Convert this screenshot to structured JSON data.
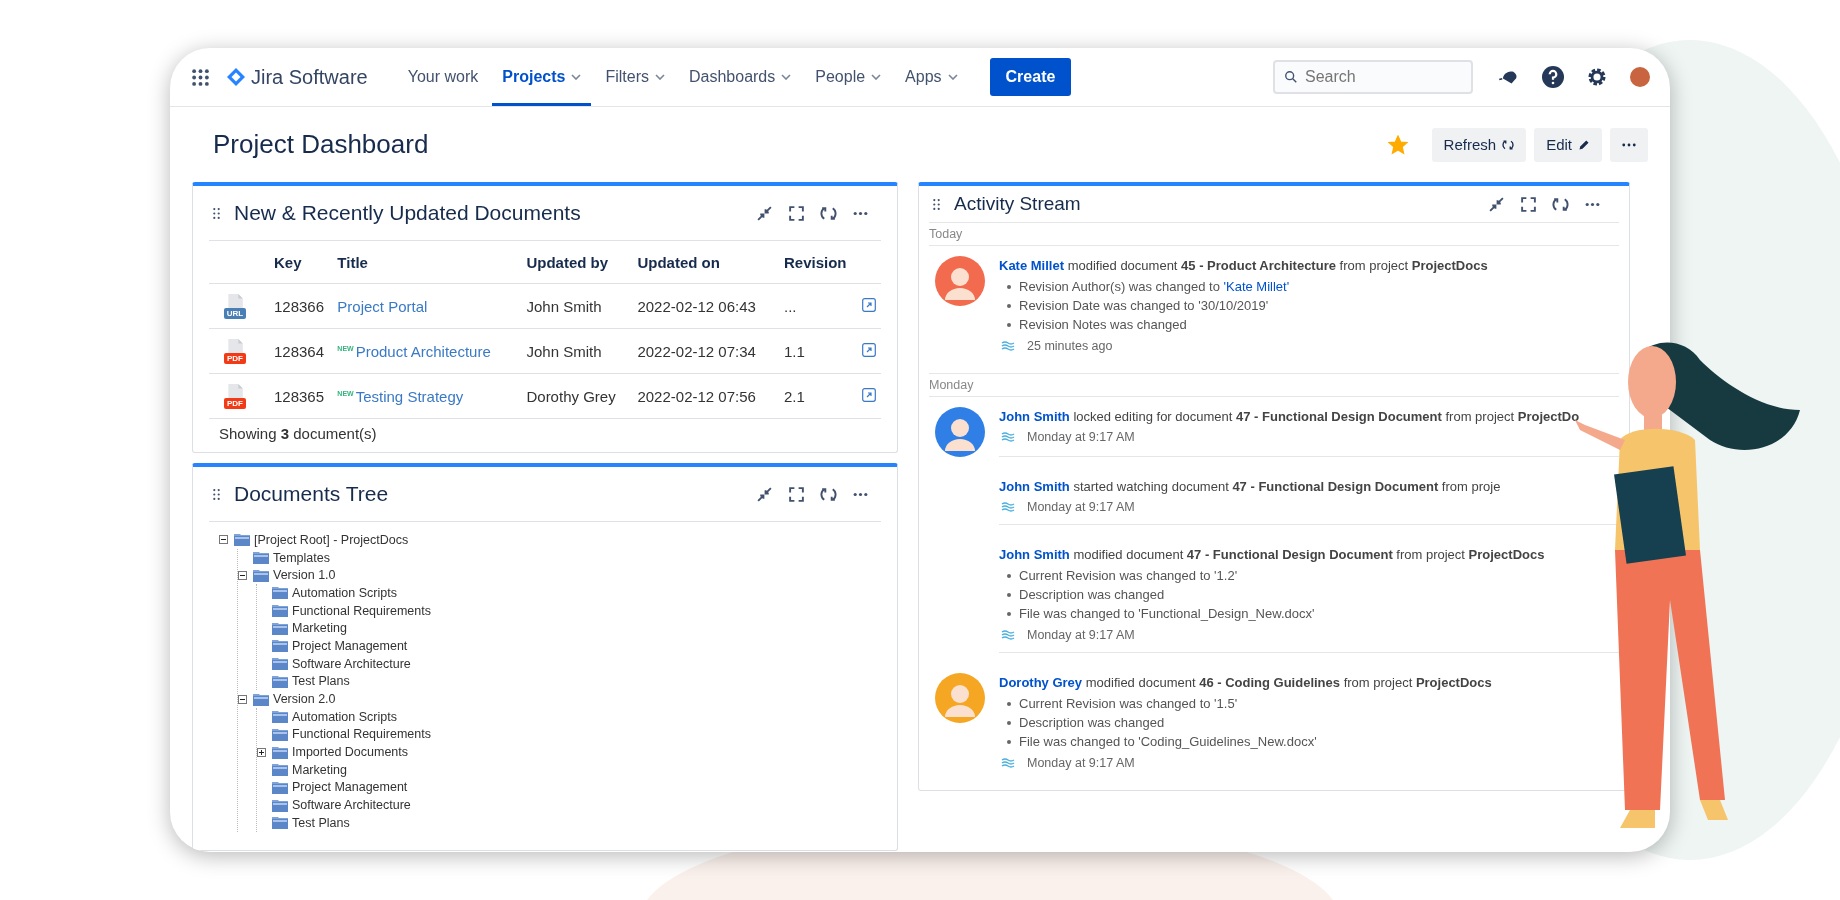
{
  "nav": {
    "product": "Jira Software",
    "items": [
      {
        "label": "Your work",
        "selected": false,
        "has_menu": false
      },
      {
        "label": "Projects",
        "selected": true,
        "has_menu": true
      },
      {
        "label": "Filters",
        "selected": false,
        "has_menu": true
      },
      {
        "label": "Dashboards",
        "selected": false,
        "has_menu": true
      },
      {
        "label": "People",
        "selected": false,
        "has_menu": true
      },
      {
        "label": "Apps",
        "selected": false,
        "has_menu": true
      }
    ],
    "create": "Create",
    "search": {
      "placeholder": "Search"
    }
  },
  "page": {
    "title": "Project Dashboard",
    "starred": true,
    "buttons": [
      "Refresh",
      "Edit"
    ]
  },
  "documents": {
    "title": "New & Recently Updated Documents",
    "columns": [
      "Key",
      "Title",
      "Updated by",
      "Updated on",
      "Revision"
    ],
    "rows": [
      {
        "kind": "url",
        "file_label": "URL",
        "key": "128366",
        "title": "Project Portal",
        "updated_by": "John Smith",
        "updated_on": "2022-02-12 06:43",
        "revision": "..."
      },
      {
        "kind": "pdf",
        "file_label": "PDF",
        "key": "128364",
        "badge": "NEW",
        "title": "Product Architecture",
        "updated_by": "John Smith",
        "updated_on": "2022-02-12 07:34",
        "revision": "1.1"
      },
      {
        "kind": "pdf",
        "file_label": "PDF",
        "key": "128365",
        "badge": "NEW",
        "title": "Testing Strategy",
        "updated_by": "Dorothy Grey",
        "updated_on": "2022-02-12 07:56",
        "revision": "2.1"
      }
    ],
    "footer": "Showing **3** document(s)"
  },
  "tree": {
    "title": "Documents Tree",
    "nodes": [
      {
        "label": "[Project Root] - ProjectDocs",
        "expanded": true,
        "children": [
          {
            "label": "Templates"
          },
          {
            "label": "Version 1.0",
            "expanded": true,
            "children": [
              {
                "label": "Automation Scripts"
              },
              {
                "label": "Functional Requirements"
              },
              {
                "label": "Marketing"
              },
              {
                "label": "Project Management"
              },
              {
                "label": "Software Architecture"
              },
              {
                "label": "Test Plans"
              }
            ]
          },
          {
            "label": "Version 2.0",
            "expanded": true,
            "children": [
              {
                "label": "Automation Scripts"
              },
              {
                "label": "Functional Requirements"
              },
              {
                "label": "Imported Documents",
                "expanded": false
              },
              {
                "label": "Marketing"
              },
              {
                "label": "Project Management"
              },
              {
                "label": "Software Architecture"
              },
              {
                "label": "Test Plans"
              }
            ]
          }
        ]
      }
    ]
  },
  "activity": {
    "title": "Activity Stream",
    "groups": [
      {
        "day": "Today",
        "entries": [
          {
            "avatar": true,
            "color": "#f26b4f",
            "actor": "Kate Millet",
            "action": "modified document **45 - Product Architecture** from project **ProjectDocs**",
            "changes": [
              {
                "text": "Revision Author(s) was changed to ",
                "link": "'Kate Millet'"
              },
              {
                "text": "Revision Date was changed to '30/10/2019'"
              },
              {
                "text": "Revision Notes was changed"
              }
            ],
            "time": "25 minutes ago"
          }
        ]
      },
      {
        "day": "Monday",
        "entries": [
          {
            "avatar": true,
            "color": "#2f7fe6",
            "actor": "John Smith",
            "action": "locked editing for document **47 - Functional Design Document** from project **ProjectDo**",
            "time": "Monday at 9:17 AM"
          },
          {
            "avatar": false,
            "actor": "John Smith",
            "action": "started watching document **47 - Functional Design Document** from proje",
            "time": "Monday at 9:17 AM"
          },
          {
            "avatar": false,
            "actor": "John Smith",
            "action": "modified document **47 - Functional Design Document** from project **ProjectDocs**",
            "changes": [
              {
                "text": "Current Revision was changed to '1.2'"
              },
              {
                "text": "Description was changed"
              },
              {
                "text": "File was changed to 'Functional_Design_New.docx'"
              }
            ],
            "time": "Monday at 9:17 AM"
          },
          {
            "avatar": true,
            "color": "#f5a623",
            "actor": "Dorothy Grey",
            "action": "modified document **46 - Coding Guidelines** from project **ProjectDocs**",
            "changes": [
              {
                "text": "Current Revision was changed to '1.5'"
              },
              {
                "text": "Description was changed"
              },
              {
                "text": "File was changed to 'Coding_Guidelines_New.docx'"
              }
            ],
            "time": "Monday at 9:17 AM"
          }
        ]
      }
    ]
  }
}
